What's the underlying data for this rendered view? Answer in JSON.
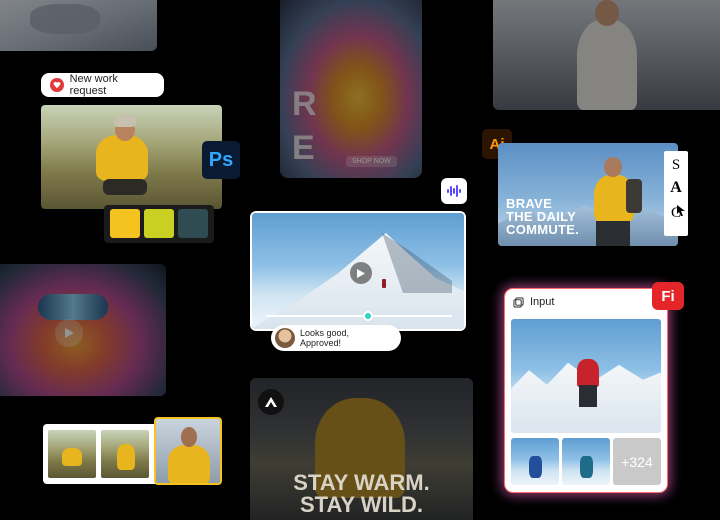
{
  "request_pill": {
    "label": "New work request",
    "color": "#e03b3b"
  },
  "photoshop_badge": {
    "label": "Ps",
    "bg": "#0a1a33",
    "fg": "#31a8ff"
  },
  "illustrator_badge": {
    "label": "Ai",
    "bg": "#2b1500",
    "fg": "#ff9a00"
  },
  "firefly_badge": {
    "label": "Fi",
    "bg": "#e4262a",
    "fg": "#ffffff"
  },
  "palette": {
    "swatches": [
      "#f4c320",
      "#c9d021",
      "#2e4c52"
    ]
  },
  "hoodie_poster": {
    "vertical_text": "R E Q",
    "tag": "SHOP NOW"
  },
  "ad_banner": {
    "headline_line1": "BRAVE",
    "headline_line2": "THE DAILY",
    "headline_line3": "COMMUTE."
  },
  "font_tool": {
    "glyph_s": "S",
    "glyph_a": "A",
    "glyph_c": "C"
  },
  "video_review": {
    "comment": "Looks good, Approved!",
    "progress": 0.55
  },
  "input_panel": {
    "title": "Input",
    "more_count": "+324"
  },
  "bottom_poster": {
    "line1": "STAY WARM.",
    "line2": "STAY WILD."
  }
}
